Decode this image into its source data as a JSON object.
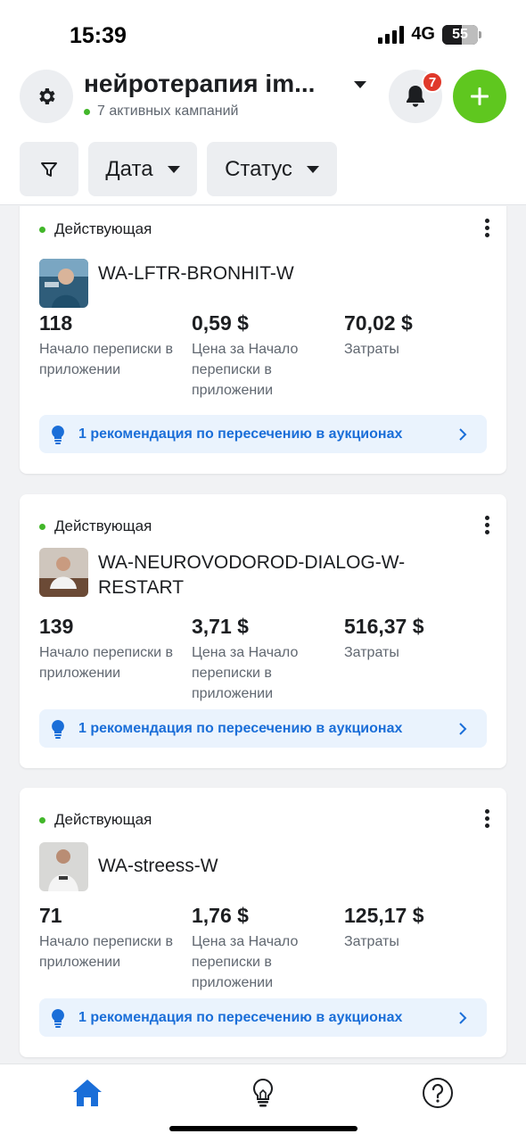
{
  "status_bar": {
    "time": "15:39",
    "network": "4G",
    "battery": "55"
  },
  "header": {
    "account_name": "нейротерапия im...",
    "active_campaigns": "7 активных кампаний",
    "notifications_count": "7",
    "accent_color": "#5fc71f"
  },
  "filters": {
    "date_label": "Дата",
    "status_label": "Статус"
  },
  "campaigns": [
    {
      "status": "Действующая",
      "name": "WA-LFTR-BRONHIT-W",
      "metric1_value": "118",
      "metric1_label": "Начало переписки в приложении",
      "metric2_value": "0,59 $",
      "metric2_label": "Цена за Начало переписки в приложении",
      "metric3_value": "70,02 $",
      "metric3_label": "Затраты",
      "recommendation": "1 рекомендация по пересечению в аукционах"
    },
    {
      "status": "Действующая",
      "name": "WA-NEUROVODOROD-DIALOG-W-RESTART",
      "metric1_value": "139",
      "metric1_label": "Начало переписки в приложении",
      "metric2_value": "3,71 $",
      "metric2_label": "Цена за Начало переписки в приложении",
      "metric3_value": "516,37 $",
      "metric3_label": "Затраты",
      "recommendation": "1 рекомендация по пересечению в аукционах"
    },
    {
      "status": "Действующая",
      "name": "WA-streess-W",
      "metric1_value": "71",
      "metric1_label": "Начало переписки в приложении",
      "metric2_value": "1,76 $",
      "metric2_label": "Цена за Начало переписки в приложении",
      "metric3_value": "125,17 $",
      "metric3_label": "Затраты",
      "recommendation": "1 рекомендация по пересечению в аукционах"
    }
  ],
  "bottom_nav": {
    "items": [
      "home-icon",
      "lightbulb-icon",
      "help-icon"
    ],
    "active_color": "#1a6ed8"
  }
}
